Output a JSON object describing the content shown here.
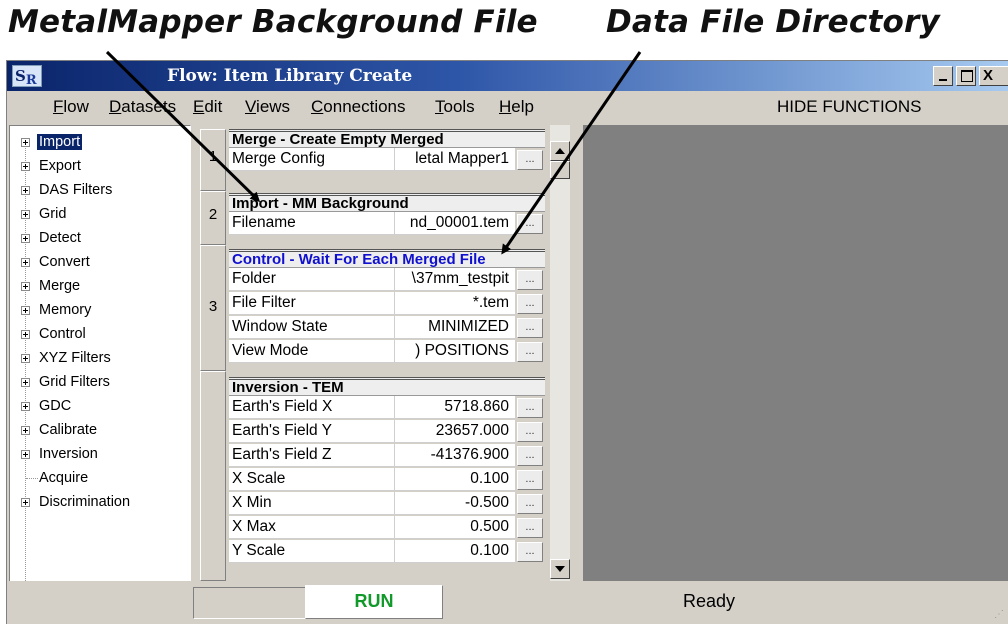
{
  "annotations": {
    "left": "MetalMapper Background File",
    "right": "Data File Directory"
  },
  "window": {
    "icon_text": "S",
    "icon_sub": "R",
    "title": "Flow: Item Library Create",
    "minimize_glyph": "_",
    "close_glyph": "X"
  },
  "menu": {
    "items": [
      "Flow",
      "Datasets",
      "Edit",
      "Views",
      "Connections",
      "Tools",
      "Help"
    ],
    "hide_functions": "HIDE FUNCTIONS"
  },
  "tree": {
    "items": [
      "Import",
      "Export",
      "DAS Filters",
      "Grid",
      "Detect",
      "Convert",
      "Merge",
      "Memory",
      "Control",
      "XYZ Filters",
      "Grid Filters",
      "GDC",
      "Calibrate",
      "Inversion",
      "Acquire",
      "Discrimination"
    ],
    "selected": "Import"
  },
  "steps": [
    "1",
    "2",
    "3"
  ],
  "sections": [
    {
      "title": "Merge - Create Empty Merged",
      "rows": [
        {
          "label": "Merge Config",
          "value": "letal Mapper1"
        }
      ]
    },
    {
      "title": "Import - MM Background",
      "rows": [
        {
          "label": "Filename",
          "value": "nd_00001.tem"
        }
      ]
    },
    {
      "title": "Control - Wait For Each Merged File",
      "rows": [
        {
          "label": "Folder",
          "value": "\\37mm_testpit"
        },
        {
          "label": "File Filter",
          "value": "*.tem"
        },
        {
          "label": "Window State",
          "value": "MINIMIZED"
        },
        {
          "label": "View Mode",
          "value": ") POSITIONS"
        }
      ]
    },
    {
      "title": "Inversion - TEM",
      "rows": [
        {
          "label": "Earth's Field X",
          "value": "5718.860"
        },
        {
          "label": "Earth's Field Y",
          "value": "23657.000"
        },
        {
          "label": "Earth's Field Z",
          "value": "-41376.900"
        },
        {
          "label": "X Scale",
          "value": "0.100"
        },
        {
          "label": "X Min",
          "value": "-0.500"
        },
        {
          "label": "X Max",
          "value": "0.500"
        },
        {
          "label": "Y Scale",
          "value": "0.100"
        }
      ]
    }
  ],
  "ellipsis": "...",
  "status": {
    "run_label": "RUN",
    "text": "Ready"
  },
  "colors": {
    "title_bar": "#0a246a",
    "selection": "#0a246a",
    "section_highlight": "#1010d0",
    "run_text": "#119a2a",
    "canvas": "#808080"
  }
}
